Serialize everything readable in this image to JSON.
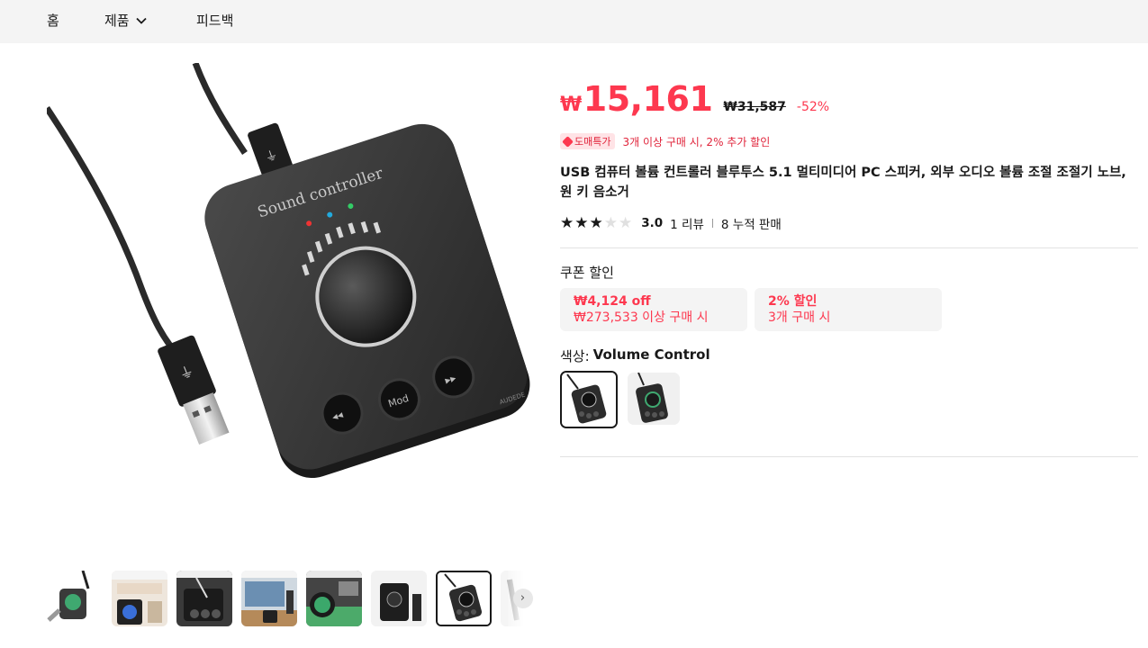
{
  "nav": {
    "home": "홈",
    "products": "제품",
    "feedback": "피드백"
  },
  "image": {
    "device_label": "Sound controller",
    "button_mid": "Mod",
    "brand": "AUDEDE"
  },
  "thumbnails": [
    {
      "name": "thumb-1"
    },
    {
      "name": "thumb-2"
    },
    {
      "name": "thumb-3"
    },
    {
      "name": "thumb-4"
    },
    {
      "name": "thumb-5"
    },
    {
      "name": "thumb-6"
    },
    {
      "name": "thumb-7"
    },
    {
      "name": "thumb-8"
    }
  ],
  "price": {
    "currency": "₩",
    "current": "15,161",
    "original": "₩31,587",
    "discount": "-52%"
  },
  "promo": {
    "tag": "도매특가",
    "text": "3개 이상 구매 시, 2% 추가 할인"
  },
  "product": {
    "title": "USB 컴퓨터 볼륨 컨트롤러 블루투스 5.1 멀티미디어 PC 스피커, 외부 오디오 볼륨 조절 조절기 노브, 원 키 음소거"
  },
  "rating": {
    "stars_filled": 3,
    "stars_total": 5,
    "score": "3.0",
    "reviews": "1 리뷰",
    "sold": "8 누적 판매"
  },
  "coupons": {
    "label": "쿠폰 할인",
    "items": [
      {
        "line1": "₩4,124 off",
        "line2": "₩273,533 이상 구매 시"
      },
      {
        "line1": "2% 할인",
        "line2": "3개 구매 시"
      }
    ]
  },
  "color": {
    "label": "색상:",
    "value": "Volume Control"
  },
  "colors": {
    "accent": "#fd384f",
    "text": "#191919",
    "nav_bg": "#f4f4f4"
  }
}
